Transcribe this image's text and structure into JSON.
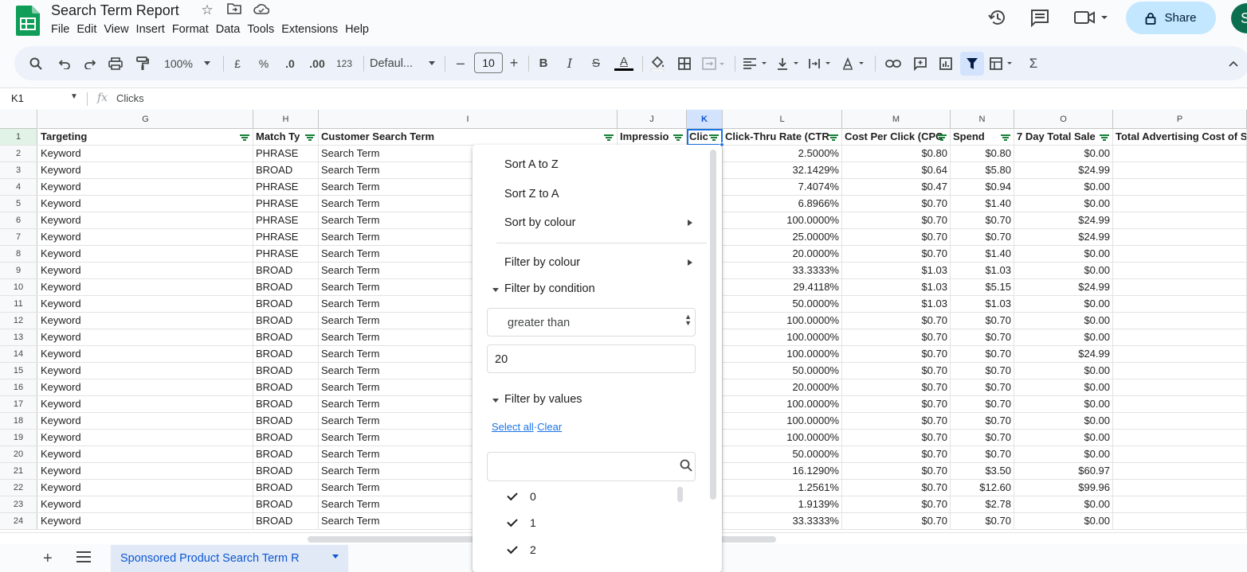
{
  "app": {
    "title": "Search Term Report",
    "menu": [
      "File",
      "Edit",
      "View",
      "Insert",
      "Format",
      "Data",
      "Tools",
      "Extensions",
      "Help"
    ],
    "share_label": "Share",
    "avatar_letter": "S"
  },
  "toolbar": {
    "zoom": "100%",
    "currency": "£",
    "percent": "%",
    "decrease_decimals": ".0",
    "increase_decimals": ".00",
    "more_formats": "123",
    "font": "Defaul...",
    "font_size": "10",
    "bold": "B",
    "italic": "I",
    "strike": "S",
    "text_color": "A",
    "sum": "Σ"
  },
  "formula_bar": {
    "cell_ref": "K1",
    "fx": "fx",
    "content": "Clicks"
  },
  "columns": [
    "G",
    "H",
    "I",
    "J",
    "K",
    "L",
    "M",
    "N",
    "O",
    "P"
  ],
  "headers": [
    "Targeting",
    "Match Ty",
    "Customer Search Term",
    "Impressio",
    "Clic",
    "Click-Thru Rate (CTR",
    "Cost Per Click (CPC",
    "Spend",
    "7 Day Total Sale",
    "Total Advertising Cost of S"
  ],
  "rows": [
    {
      "n": "2",
      "targeting": "Keyword",
      "match": "PHRASE",
      "term": "Search Term",
      "ctr": "2.5000%",
      "cpc": "$0.80",
      "spend": "$0.80",
      "sales": "$0.00"
    },
    {
      "n": "3",
      "targeting": "Keyword",
      "match": "BROAD",
      "term": "Search Term",
      "ctr": "32.1429%",
      "cpc": "$0.64",
      "spend": "$5.80",
      "sales": "$24.99"
    },
    {
      "n": "4",
      "targeting": "Keyword",
      "match": "PHRASE",
      "term": "Search Term",
      "ctr": "7.4074%",
      "cpc": "$0.47",
      "spend": "$0.94",
      "sales": "$0.00"
    },
    {
      "n": "5",
      "targeting": "Keyword",
      "match": "PHRASE",
      "term": "Search Term",
      "ctr": "6.8966%",
      "cpc": "$0.70",
      "spend": "$1.40",
      "sales": "$0.00"
    },
    {
      "n": "6",
      "targeting": "Keyword",
      "match": "PHRASE",
      "term": "Search Term",
      "ctr": "100.0000%",
      "cpc": "$0.70",
      "spend": "$0.70",
      "sales": "$24.99"
    },
    {
      "n": "7",
      "targeting": "Keyword",
      "match": "PHRASE",
      "term": "Search Term",
      "ctr": "25.0000%",
      "cpc": "$0.70",
      "spend": "$0.70",
      "sales": "$24.99"
    },
    {
      "n": "8",
      "targeting": "Keyword",
      "match": "PHRASE",
      "term": "Search Term",
      "ctr": "20.0000%",
      "cpc": "$0.70",
      "spend": "$1.40",
      "sales": "$0.00"
    },
    {
      "n": "9",
      "targeting": "Keyword",
      "match": "BROAD",
      "term": "Search Term",
      "ctr": "33.3333%",
      "cpc": "$1.03",
      "spend": "$1.03",
      "sales": "$0.00"
    },
    {
      "n": "10",
      "targeting": "Keyword",
      "match": "BROAD",
      "term": "Search Term",
      "ctr": "29.4118%",
      "cpc": "$1.03",
      "spend": "$5.15",
      "sales": "$24.99"
    },
    {
      "n": "11",
      "targeting": "Keyword",
      "match": "BROAD",
      "term": "Search Term",
      "ctr": "50.0000%",
      "cpc": "$1.03",
      "spend": "$1.03",
      "sales": "$0.00"
    },
    {
      "n": "12",
      "targeting": "Keyword",
      "match": "BROAD",
      "term": "Search Term",
      "ctr": "100.0000%",
      "cpc": "$0.70",
      "spend": "$0.70",
      "sales": "$0.00"
    },
    {
      "n": "13",
      "targeting": "Keyword",
      "match": "BROAD",
      "term": "Search Term",
      "ctr": "100.0000%",
      "cpc": "$0.70",
      "spend": "$0.70",
      "sales": "$0.00"
    },
    {
      "n": "14",
      "targeting": "Keyword",
      "match": "BROAD",
      "term": "Search Term",
      "ctr": "100.0000%",
      "cpc": "$0.70",
      "spend": "$0.70",
      "sales": "$24.99"
    },
    {
      "n": "15",
      "targeting": "Keyword",
      "match": "BROAD",
      "term": "Search Term",
      "ctr": "50.0000%",
      "cpc": "$0.70",
      "spend": "$0.70",
      "sales": "$0.00"
    },
    {
      "n": "16",
      "targeting": "Keyword",
      "match": "BROAD",
      "term": "Search Term",
      "ctr": "20.0000%",
      "cpc": "$0.70",
      "spend": "$0.70",
      "sales": "$0.00"
    },
    {
      "n": "17",
      "targeting": "Keyword",
      "match": "BROAD",
      "term": "Search Term",
      "ctr": "100.0000%",
      "cpc": "$0.70",
      "spend": "$0.70",
      "sales": "$0.00"
    },
    {
      "n": "18",
      "targeting": "Keyword",
      "match": "BROAD",
      "term": "Search Term",
      "ctr": "100.0000%",
      "cpc": "$0.70",
      "spend": "$0.70",
      "sales": "$0.00"
    },
    {
      "n": "19",
      "targeting": "Keyword",
      "match": "BROAD",
      "term": "Search Term",
      "ctr": "100.0000%",
      "cpc": "$0.70",
      "spend": "$0.70",
      "sales": "$0.00"
    },
    {
      "n": "20",
      "targeting": "Keyword",
      "match": "BROAD",
      "term": "Search Term",
      "ctr": "50.0000%",
      "cpc": "$0.70",
      "spend": "$0.70",
      "sales": "$0.00"
    },
    {
      "n": "21",
      "targeting": "Keyword",
      "match": "BROAD",
      "term": "Search Term",
      "ctr": "16.1290%",
      "cpc": "$0.70",
      "spend": "$3.50",
      "sales": "$60.97"
    },
    {
      "n": "22",
      "targeting": "Keyword",
      "match": "BROAD",
      "term": "Search Term",
      "ctr": "1.2561%",
      "cpc": "$0.70",
      "spend": "$12.60",
      "sales": "$99.96"
    },
    {
      "n": "23",
      "targeting": "Keyword",
      "match": "BROAD",
      "term": "Search Term",
      "ctr": "1.9139%",
      "cpc": "$0.70",
      "spend": "$2.78",
      "sales": "$0.00"
    },
    {
      "n": "24",
      "targeting": "Keyword",
      "match": "BROAD",
      "term": "Search Term",
      "ctr": "33.3333%",
      "cpc": "$0.70",
      "spend": "$0.70",
      "sales": "$0.00"
    }
  ],
  "filter_menu": {
    "sort_az": "Sort A to Z",
    "sort_za": "Sort Z to A",
    "sort_colour": "Sort by colour",
    "filter_colour": "Filter by colour",
    "filter_condition": "Filter by condition",
    "condition": "greater than",
    "condition_value": "20",
    "filter_values": "Filter by values",
    "select_all": "Select all",
    "dot": "·",
    "clear": "Clear",
    "values": [
      "0",
      "1",
      "2"
    ]
  },
  "sheet_tab": "Sponsored Product Search Term R",
  "colors": {
    "accent": "#0b57d0",
    "share_bg": "#c2e7ff",
    "selected_col_header": "#d3e3fd",
    "filtered_header": "#e1f3e6",
    "filter_icon": "#188038"
  }
}
